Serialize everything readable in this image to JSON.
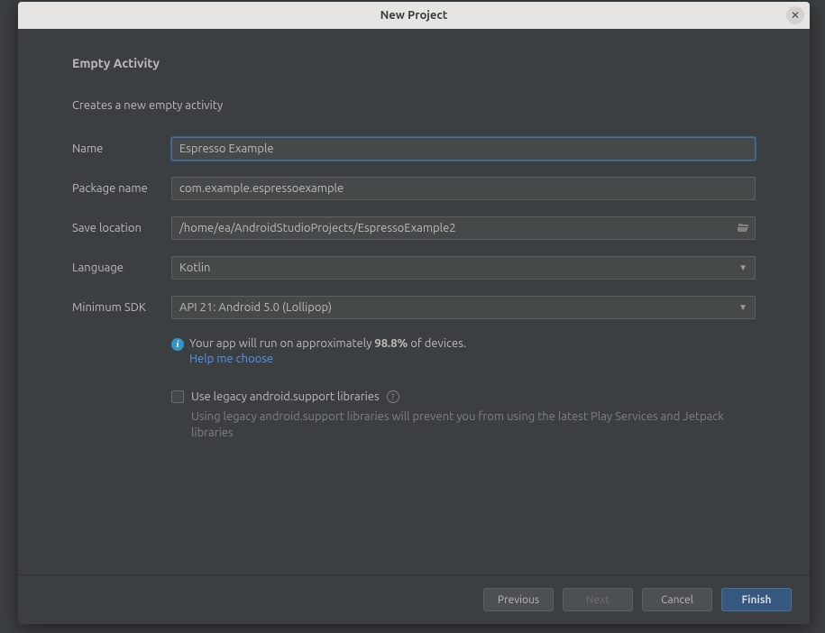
{
  "dialog": {
    "title": "New Project",
    "heading": "Empty Activity",
    "description": "Creates a new empty activity"
  },
  "form": {
    "name": {
      "label": "Name",
      "value": "Espresso Example"
    },
    "package": {
      "label": "Package name",
      "value": "com.example.espressoexample"
    },
    "location": {
      "label": "Save location",
      "value": "/home/ea/AndroidStudioProjects/EspressoExample2"
    },
    "language": {
      "label": "Language",
      "value": "Kotlin"
    },
    "minsdk": {
      "label": "Minimum SDK",
      "value": "API 21: Android 5.0 (Lollipop)"
    }
  },
  "info": {
    "text_prefix": "Your app will run on approximately ",
    "percent": "98.8%",
    "text_suffix": " of devices.",
    "help_link": "Help me choose"
  },
  "legacy": {
    "label": "Use legacy android.support libraries",
    "note": "Using legacy android.support libraries will prevent you from using the latest Play Services and Jetpack libraries"
  },
  "buttons": {
    "previous": "Previous",
    "next": "Next",
    "cancel": "Cancel",
    "finish": "Finish"
  }
}
